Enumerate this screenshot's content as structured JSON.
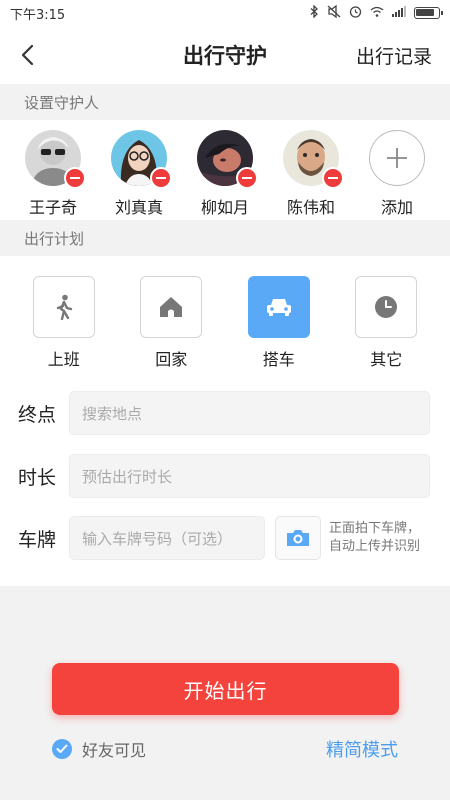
{
  "status_bar": {
    "time": "下午3:15"
  },
  "nav": {
    "title": "出行守护",
    "right_label": "出行记录"
  },
  "guardians_section": {
    "title": "设置守护人"
  },
  "guardians": [
    {
      "name": "王子奇",
      "avatar": "avatar-woman-sunglasses"
    },
    {
      "name": "刘真真",
      "avatar": "avatar-woman-glasses"
    },
    {
      "name": "柳如月",
      "avatar": "avatar-woman-dark"
    },
    {
      "name": "陈伟和",
      "avatar": "avatar-man-beard"
    }
  ],
  "add_guardian": {
    "label": "添加"
  },
  "plan_section": {
    "title": "出行计划"
  },
  "modes": [
    {
      "label": "上班",
      "icon": "walking-icon",
      "active": false
    },
    {
      "label": "回家",
      "icon": "home-icon",
      "active": false
    },
    {
      "label": "搭车",
      "icon": "car-icon",
      "active": true
    },
    {
      "label": "其它",
      "icon": "clock-icon",
      "active": false
    }
  ],
  "form": {
    "destination": {
      "label": "终点",
      "placeholder": "搜索地点"
    },
    "duration": {
      "label": "时长",
      "placeholder": "预估出行时长"
    },
    "plate": {
      "label": "车牌",
      "placeholder": "输入车牌号码（可选）",
      "hint_line1": "正面拍下车牌，",
      "hint_line2": "自动上传并识别"
    }
  },
  "start_button": {
    "label": "开始出行"
  },
  "friends_visible": {
    "label": "好友可见",
    "checked": true
  },
  "simple_mode": {
    "label": "精简模式"
  },
  "colors": {
    "accent": "#5aa9f6",
    "danger": "#f4433c",
    "link": "#4a9ef0"
  }
}
